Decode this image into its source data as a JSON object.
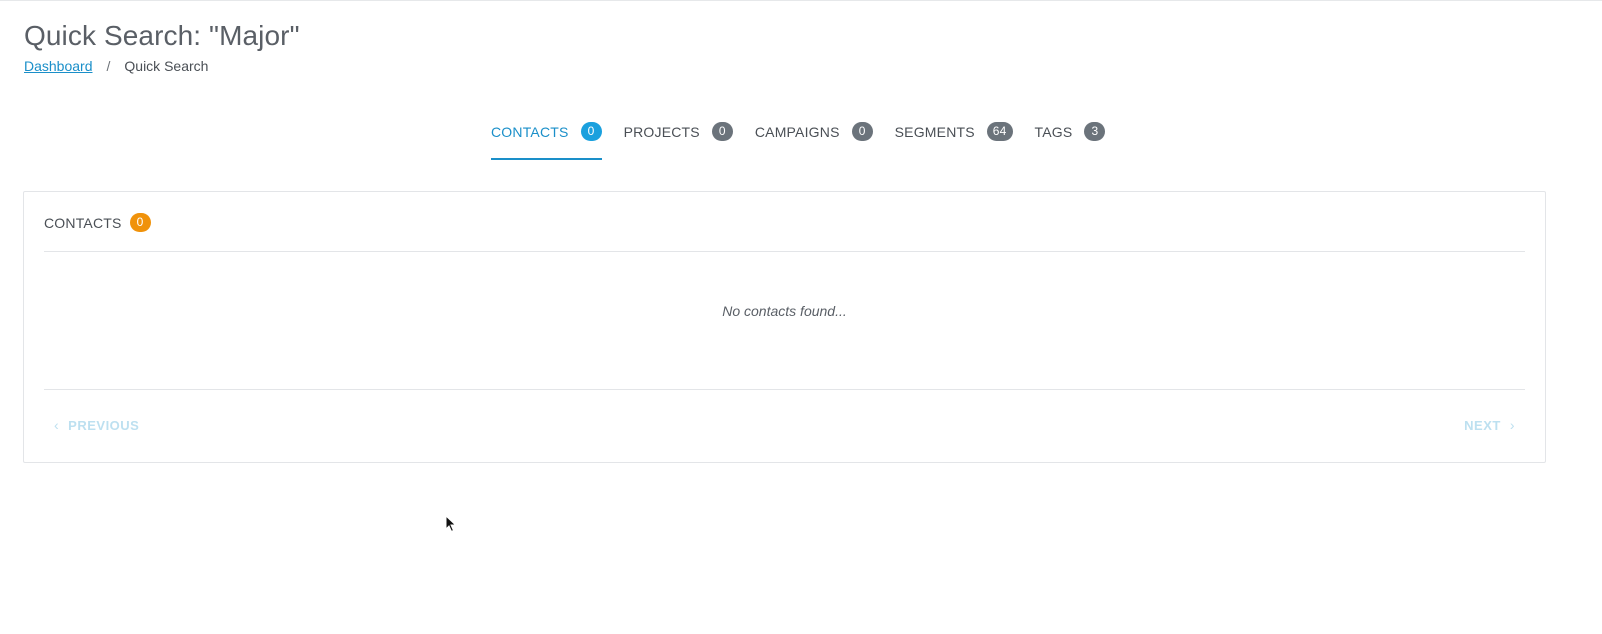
{
  "page": {
    "title": "Quick Search: \"Major\""
  },
  "breadcrumb": {
    "home": "Dashboard",
    "separator": "/",
    "current": "Quick Search"
  },
  "tabs": [
    {
      "label": "CONTACTS",
      "count": "0",
      "active": true
    },
    {
      "label": "PROJECTS",
      "count": "0",
      "active": false
    },
    {
      "label": "CAMPAIGNS",
      "count": "0",
      "active": false
    },
    {
      "label": "SEGMENTS",
      "count": "64",
      "active": false
    },
    {
      "label": "TAGS",
      "count": "3",
      "active": false
    }
  ],
  "panel": {
    "title": "CONTACTS",
    "count": "0",
    "empty_message": "No contacts found...",
    "prev_label": "PREVIOUS",
    "next_label": "NEXT",
    "prev_icon": "chevron-left-icon",
    "next_icon": "chevron-right-icon"
  },
  "colors": {
    "accent": "#1a8fc9",
    "active_badge": "#1aa0de",
    "badge": "#6b737b",
    "panel_badge": "#f0920a",
    "disabled_pager": "#bde0f0"
  }
}
